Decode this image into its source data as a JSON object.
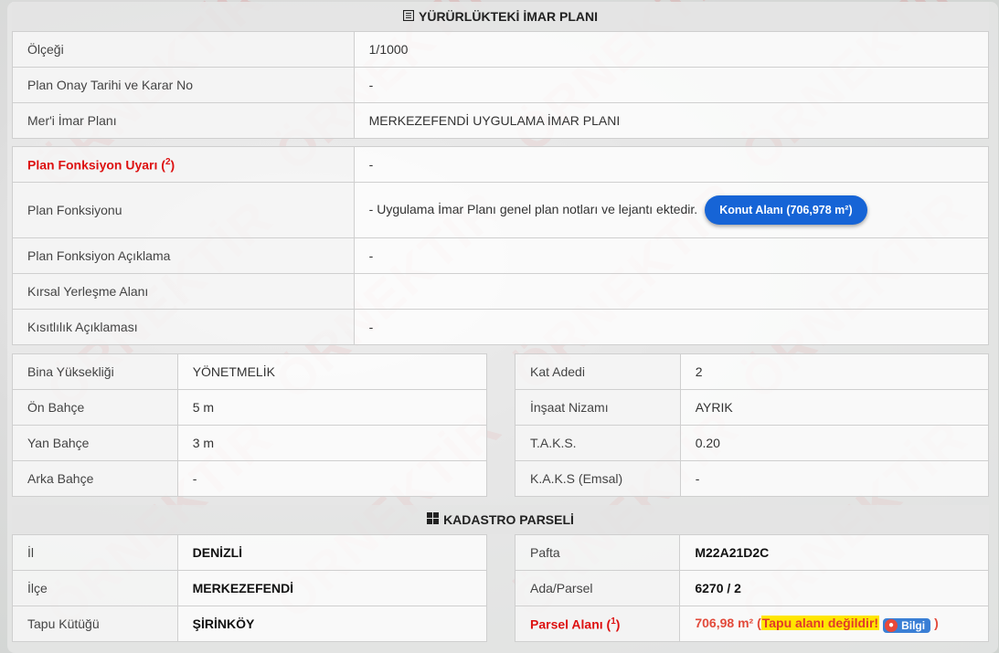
{
  "watermark": "ÖRNEKTİR",
  "colors": {
    "accent": "#1664d6",
    "warning_red": "#d11111",
    "highlight": "#ffe600"
  },
  "section1": {
    "icon": "document-list-icon",
    "title": "YÜRÜRLÜKTEKİ İMAR PLANI",
    "rows": [
      {
        "label": "Ölçeği",
        "value": "1/1000"
      },
      {
        "label": "Plan Onay Tarihi ve Karar No",
        "value": "-"
      },
      {
        "label": "Mer'i İmar Planı",
        "value": "MERKEZEFENDİ UYGULAMA İMAR PLANI"
      }
    ],
    "warning_label": "Plan Fonksiyon Uyarı (",
    "warning_sup": "2",
    "warning_close": ")",
    "warning_value": "-",
    "function_label": "Plan Fonksiyonu",
    "function_value": "- Uygulama İmar Planı genel plan notları ve lejantı ektedir.",
    "function_button": "Konut Alanı (706,978 m²)",
    "rows2": [
      {
        "label": "Plan Fonksiyon Açıklama",
        "value": "-"
      },
      {
        "label": "Kırsal Yerleşme Alanı",
        "value": ""
      },
      {
        "label": "Kısıtlılık Açıklaması",
        "value": "-"
      }
    ]
  },
  "building": {
    "left": [
      {
        "label": "Bina Yüksekliği",
        "value": "YÖNETMELİK"
      },
      {
        "label": "Ön Bahçe",
        "value": "5 m"
      },
      {
        "label": "Yan Bahçe",
        "value": "3 m"
      },
      {
        "label": "Arka Bahçe",
        "value": "-"
      }
    ],
    "right": [
      {
        "label": "Kat Adedi",
        "value": "2"
      },
      {
        "label": "İnşaat Nizamı",
        "value": "AYRIK"
      },
      {
        "label": "T.A.K.S.",
        "value": "0.20"
      },
      {
        "label": "K.A.K.S (Emsal)",
        "value": "-"
      }
    ]
  },
  "section2": {
    "icon": "grid-icon",
    "title": "KADASTRO PARSELİ",
    "left": [
      {
        "label": "İl",
        "value": "DENİZLİ"
      },
      {
        "label": "İlçe",
        "value": "MERKEZEFENDİ"
      },
      {
        "label": "Tapu Kütüğü",
        "value": "ŞİRİNKÖY"
      }
    ],
    "right": [
      {
        "label": "Pafta",
        "value": "M22A21D2C"
      },
      {
        "label": "Ada/Parsel",
        "value": "6270 / 2"
      }
    ],
    "parcel_label": "Parsel Alanı (",
    "parcel_sup": "1",
    "parcel_close": ")",
    "parcel_area": "706,98 m²",
    "parcel_open": "(",
    "parcel_note": "Tapu alanı değildir!",
    "parcel_button": "Bilgi",
    "parcel_end": ")"
  }
}
